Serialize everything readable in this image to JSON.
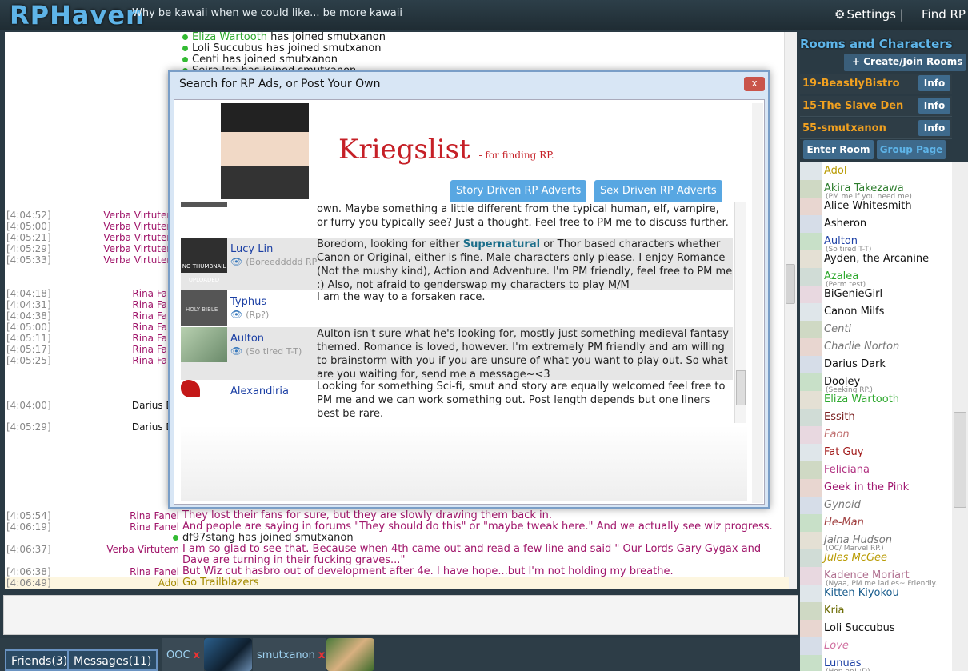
{
  "header": {
    "logo": "RPHaven",
    "tagline": "Why be kawaii when we could like... be more kawaii",
    "settings": "Settings |",
    "find_rp": "Find RP"
  },
  "chat": {
    "top_lines": [
      {
        "name": "Eliza Wartooth",
        "text": " has joined smutxanon",
        "color": "#2da82d"
      },
      {
        "name": "Loli Succubus",
        "text": " has joined smutxanon",
        "color": "#222"
      },
      {
        "name": "Centi",
        "text": " has joined smutxanon",
        "color": "#222"
      },
      {
        "name": "Seira Iga",
        "text": " has joined smutxanon",
        "color": "#222"
      }
    ],
    "verba_ts": [
      "[4:04:52]",
      "[4:05:00]",
      "[4:05:21]",
      "[4:05:29]",
      "[4:05:33]"
    ],
    "verba_name": "Verba Virtuten",
    "rina_ts": [
      "[4:04:18]",
      "[4:04:31]",
      "[4:04:38]",
      "[4:05:00]",
      "[4:05:11]",
      "[4:05:17]",
      "[4:05:25]"
    ],
    "rina_name": "Rina Fane",
    "darius_ts": [
      "[4:04:00]",
      "[4:05:29]"
    ],
    "darius_name": "Darius Da",
    "bottom": [
      {
        "ts": "[4:05:54]",
        "name": "Rina Fanel",
        "text": "They lost their fans for sure, but they are slowly drawing them back in.",
        "color": "#a0156a"
      },
      {
        "ts": "[4:06:19]",
        "name": "Rina Fanel",
        "text": "And people are saying in forums \"They should do this\" or \"maybe tweak here.\" And we actually see wiz progress.",
        "color": "#a0156a"
      },
      {
        "ts": "",
        "name": "",
        "text": "df97stang has joined smutxanon",
        "color": "#222"
      },
      {
        "ts": "[4:06:37]",
        "name": "Verba Virtutem",
        "text": "I am so glad to see that. Because when 4th came out and read a few line and said \" Our Lords Gary Gygax and",
        "color": "#a0156a"
      },
      {
        "ts": "",
        "name": "",
        "text": "Dave are turning in their fucking graves...\"",
        "color": "#a0156a"
      },
      {
        "ts": "[4:06:38]",
        "name": "Rina Fanel",
        "text": "But Wiz cut hasbro out of development after 4e. I have hope...but I'm not holding my breathe.",
        "color": "#a0156a"
      },
      {
        "ts": "[4:06:49]",
        "name": "Adol",
        "text": "Go Trailblazers",
        "color": "#a38a00"
      }
    ]
  },
  "bottombar": {
    "friends": "Friends(3)",
    "messages": "Messages(11)",
    "ooc": "OOC",
    "room": "smutxanon",
    "close": "x"
  },
  "rooms": {
    "title": "Rooms and Characters",
    "create": "Create/Join Rooms",
    "list": [
      "19-BeastlyBistro",
      "15-The Slave Den",
      "55-smutxanon"
    ],
    "info": "Info",
    "enter": "Enter Room",
    "group": "Group Page"
  },
  "characters": [
    {
      "name": "Adol",
      "color": "#b89a00",
      "status": ""
    },
    {
      "name": "Akira Takezawa",
      "color": "#2e7d2e",
      "status": "(PM me if you need me)"
    },
    {
      "name": "Alice Whitesmith",
      "color": "#111",
      "status": ""
    },
    {
      "name": "Asheron",
      "color": "#111",
      "status": ""
    },
    {
      "name": "Aulton",
      "color": "#1b3fa4",
      "status": "(So tired T-T)"
    },
    {
      "name": "Ayden, the Arcanine",
      "color": "#111",
      "status": ""
    },
    {
      "name": "Azalea",
      "color": "#2da82d",
      "status": "(Perm test)"
    },
    {
      "name": "BiGenieGirl",
      "color": "#111",
      "status": ""
    },
    {
      "name": "Canon Milfs",
      "color": "#111",
      "status": ""
    },
    {
      "name": "Centi",
      "color": "#777",
      "status": ""
    },
    {
      "name": "Charlie Norton",
      "color": "#777",
      "status": ""
    },
    {
      "name": "Darius Dark",
      "color": "#111",
      "status": ""
    },
    {
      "name": "Dooley",
      "color": "#111",
      "status": "(Seeking RP.)"
    },
    {
      "name": "Eliza Wartooth",
      "color": "#2da82d",
      "status": ""
    },
    {
      "name": "Essith",
      "color": "#7a2020",
      "status": ""
    },
    {
      "name": "Faon",
      "color": "#c07070",
      "status": ""
    },
    {
      "name": "Fat Guy",
      "color": "#a01818",
      "status": ""
    },
    {
      "name": "Feliciana",
      "color": "#b03080",
      "status": ""
    },
    {
      "name": "Geek in the Pink",
      "color": "#a01870",
      "status": ""
    },
    {
      "name": "Gynoid",
      "color": "#777",
      "status": ""
    },
    {
      "name": "He-Man",
      "color": "#a04040",
      "status": ""
    },
    {
      "name": "Jaina Hudson",
      "color": "#777",
      "status": "(OC/ Marvel RP.)"
    },
    {
      "name": "Jules McGee",
      "color": "#b89a00",
      "status": ""
    },
    {
      "name": "Kadence Moriart",
      "color": "#b07090",
      "status": "(Nyaa, PM me ladies~ Friendly."
    },
    {
      "name": "Kitten Kiyokou",
      "color": "#1b5e8e",
      "status": ""
    },
    {
      "name": "Kria",
      "color": "#6a6a00",
      "status": ""
    },
    {
      "name": "Loli Succubus",
      "color": "#111",
      "status": ""
    },
    {
      "name": "Love",
      "color": "#d070a0",
      "status": ""
    },
    {
      "name": "Lunuas",
      "color": "#1b3fa4",
      "status": "(Hop on! :D)"
    }
  ],
  "modal": {
    "title": "Search for RP Ads, or Post Your Own",
    "close": "x",
    "brand": "Kriegslist",
    "brand_sub": "- for finding RP.",
    "tab_story": "Story Driven RP Adverts",
    "tab_sex": "Sex Driven RP Adverts",
    "ads": [
      {
        "name": "",
        "status": "",
        "text": "own. Maybe something a little different from the typical human, elf, vampire, or furry you typically see? Just a thought. Feel free to PM me to discuss further.",
        "img_label": ""
      },
      {
        "name": "Lucy Lin",
        "status": "(Boreeddddd RP",
        "text_pre": "Boredom, looking for either ",
        "text_bold": "Supernatural",
        "text": " or Thor based characters whether Canon or Original, either is fine. Male characters only please. I enjoy Romance (Not the mushy kind), Action and Adventure. I'm PM friendly, feel free to PM me :) Also, not afraid to genderswap my characters to play M/M",
        "img_label": "NO THUMBNAIL UPLOADED"
      },
      {
        "name": "Typhus",
        "status": "(Rp?)",
        "text": "I am the way to a forsaken race.",
        "img_label": "HOLY BIBLE"
      },
      {
        "name": "Aulton",
        "status": "(So tired T-T)",
        "text": "Aulton isn't sure what he's looking for, mostly just something medieval fantasy themed. Romance is loved, however. I'm extremely PM friendly and am willing to brainstorm with you if you are unsure of what you want to play out. So what are you waiting for, send me a message~<3",
        "img_label": ""
      },
      {
        "name": "Alexandiria",
        "status": "",
        "text": "Looking for something Sci-fi, smut and story are equally welcomed feel free to PM me and we can work something out. Post length depends but one liners best be rare.",
        "img_label": ""
      }
    ]
  }
}
